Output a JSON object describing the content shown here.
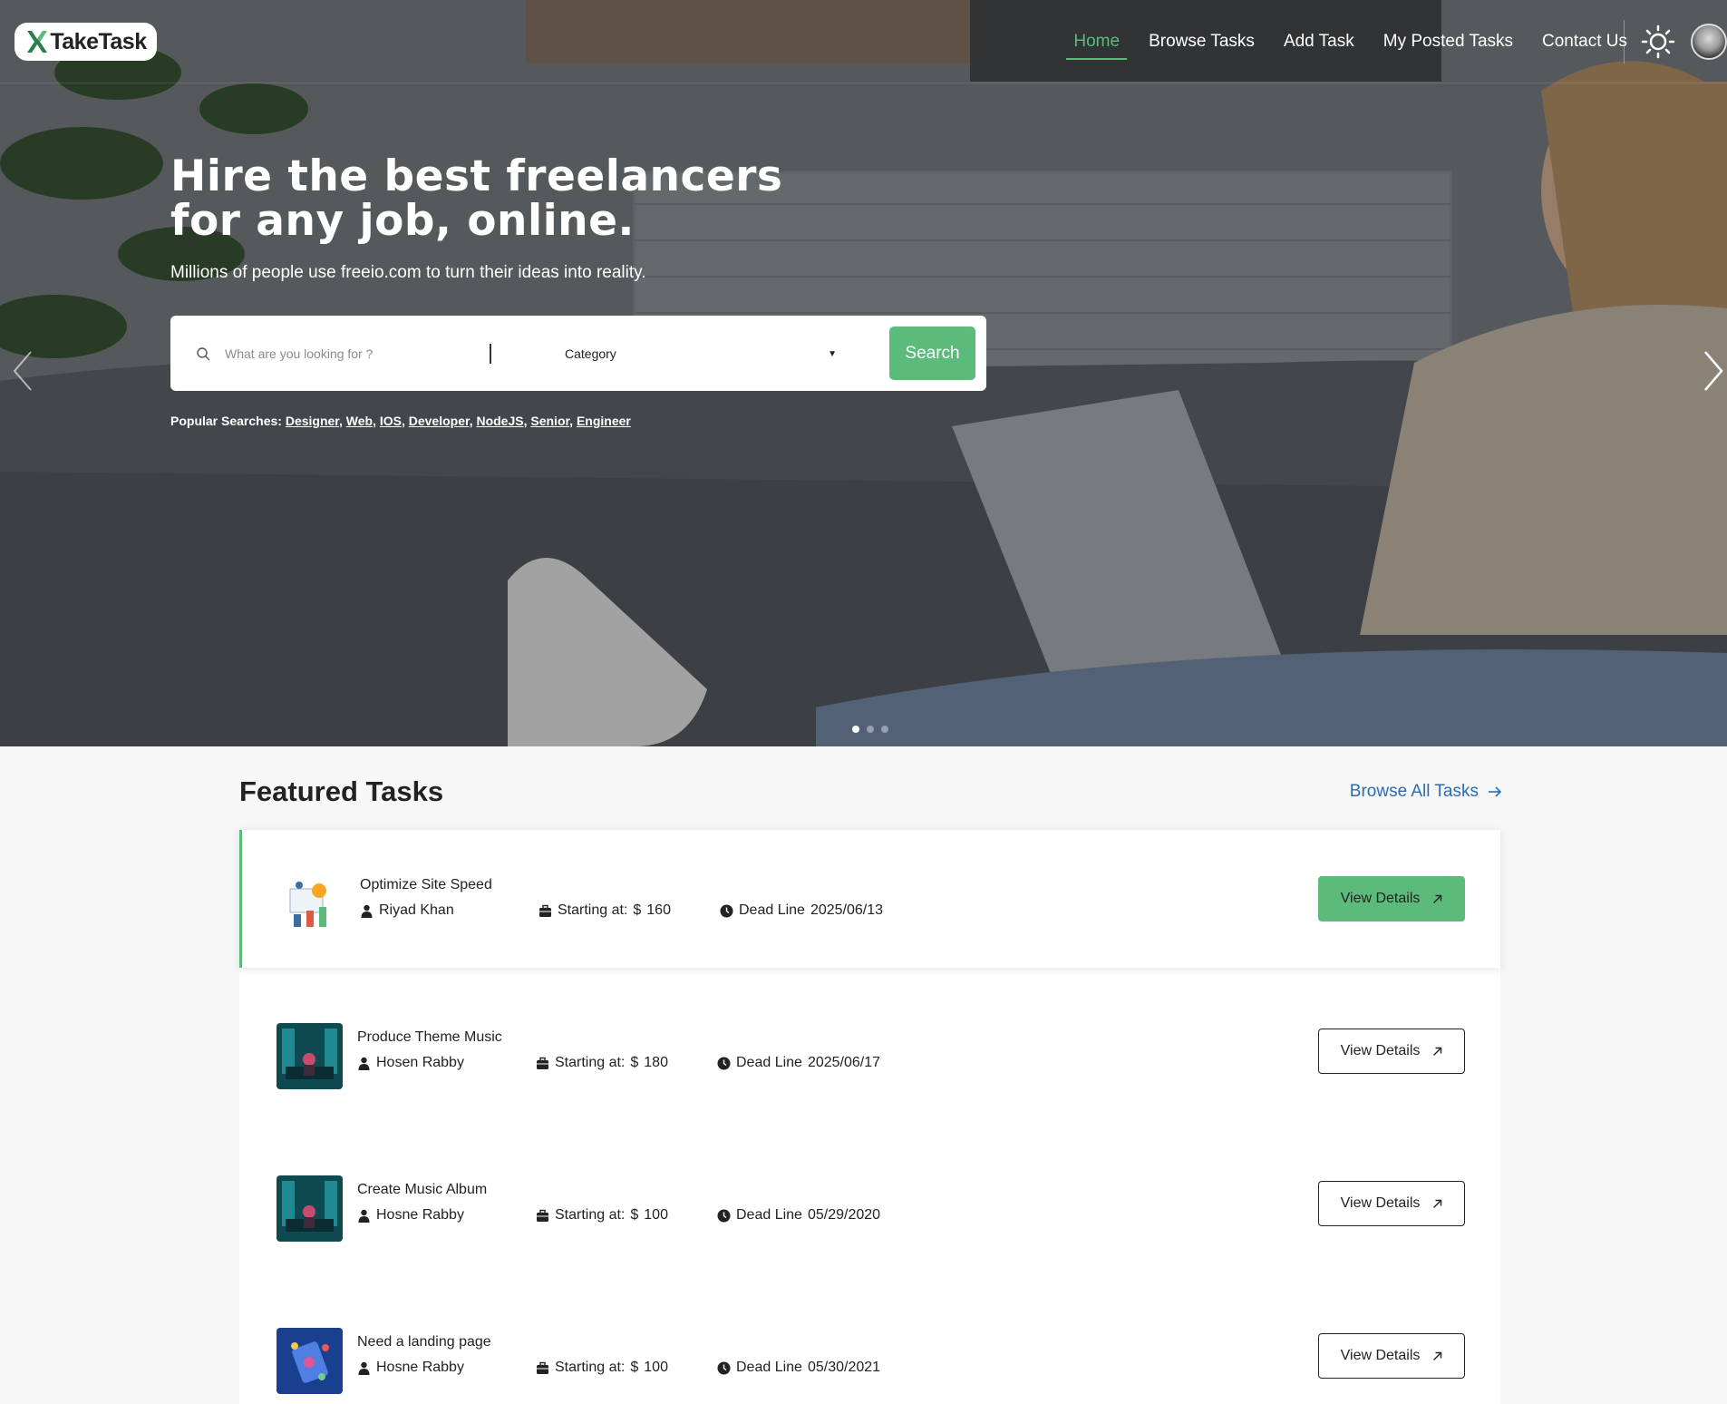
{
  "brand": {
    "name": "TakeTask"
  },
  "nav": {
    "items": [
      {
        "label": "Home",
        "active": true
      },
      {
        "label": "Browse Tasks"
      },
      {
        "label": "Add Task"
      },
      {
        "label": "My Posted Tasks"
      },
      {
        "label": "Contact Us"
      }
    ],
    "theme_icon": "sun-icon",
    "avatar_icon": "user-avatar"
  },
  "hero": {
    "headline": "Hire the best freelancers for any job, online.",
    "subline": "Millions of people use freeio.com to turn their ideas into reality.",
    "search": {
      "placeholder": "What are you looking for ?",
      "category": "Category",
      "button": "Search"
    },
    "popular": {
      "label": "Popular Searches:",
      "terms": [
        "Designer",
        "Web",
        "IOS",
        "Developer",
        "NodeJS",
        "Senior",
        "Engineer"
      ]
    },
    "slides": {
      "count": 3,
      "active_index": 0
    }
  },
  "featured": {
    "title": "Featured Tasks",
    "browse_all": "Browse All Tasks",
    "price_label": "Starting at:",
    "currency": "$",
    "deadline_label": "Dead Line",
    "view_label": "View Details",
    "tasks": [
      {
        "title": "Optimize Site Speed",
        "author": "Riyad Khan",
        "price": "160",
        "deadline": "2025/06/13",
        "thumb": "illustration"
      },
      {
        "title": "Produce Theme Music",
        "author": "Hosen Rabby",
        "price": "180",
        "deadline": "2025/06/17",
        "thumb": "studio"
      },
      {
        "title": "Create Music Album",
        "author": "Hosne Rabby",
        "price": "100",
        "deadline": "05/29/2020",
        "thumb": "studio"
      },
      {
        "title": "Need a landing page",
        "author": "Hosne Rabby",
        "price": "100",
        "deadline": "05/30/2021",
        "thumb": "blue-app"
      }
    ]
  },
  "colors": {
    "accent": "#5bbb7b",
    "link": "#2b6cb0"
  }
}
